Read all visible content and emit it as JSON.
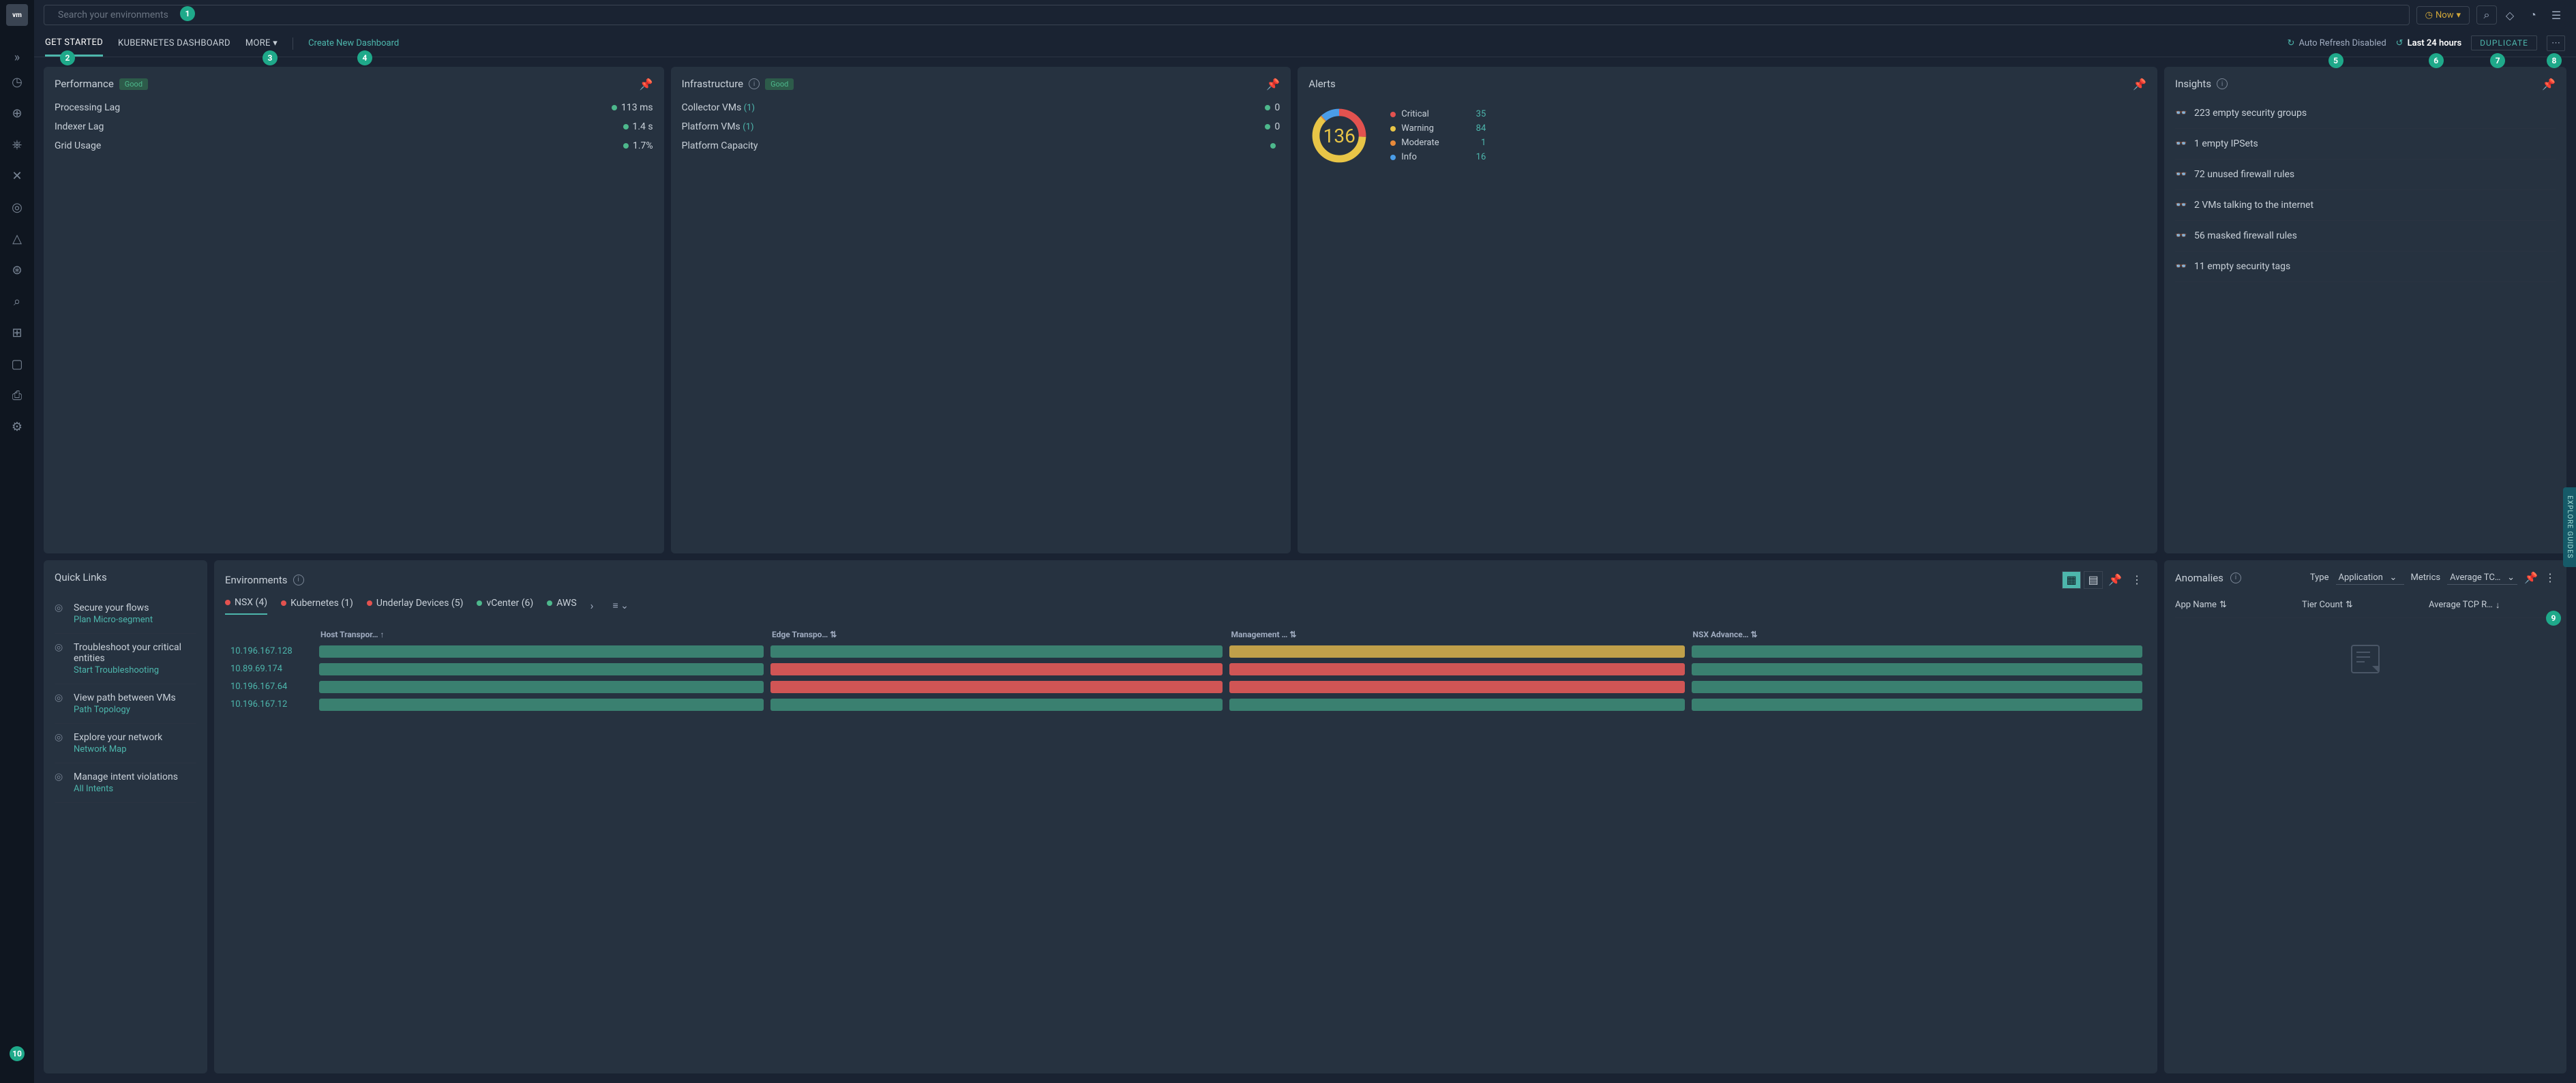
{
  "search": {
    "placeholder": "Search your environments"
  },
  "timePicker": {
    "now": "Now"
  },
  "tabs": {
    "getStarted": "GET STARTED",
    "kubernetes": "KUBERNETES DASHBOARD",
    "more": "MORE",
    "createNew": "Create New Dashboard"
  },
  "dashboardActions": {
    "autoRefresh": "Auto Refresh Disabled",
    "timeRange": "Last 24 hours",
    "duplicate": "DUPLICATE"
  },
  "performance": {
    "title": "Performance",
    "status": "Good",
    "metrics": [
      {
        "label": "Processing Lag",
        "value": "113 ms"
      },
      {
        "label": "Indexer Lag",
        "value": "1.4 s"
      },
      {
        "label": "Grid Usage",
        "value": "1.7%"
      }
    ]
  },
  "infrastructure": {
    "title": "Infrastructure",
    "status": "Good",
    "metrics": [
      {
        "label": "Collector VMs",
        "count": "(1)",
        "value": "0"
      },
      {
        "label": "Platform VMs",
        "count": "(1)",
        "value": "0"
      },
      {
        "label": "Platform Capacity",
        "value": ""
      }
    ]
  },
  "alerts": {
    "title": "Alerts",
    "total": "136",
    "legend": [
      {
        "label": "Critical",
        "count": "35",
        "color": "red"
      },
      {
        "label": "Warning",
        "count": "84",
        "color": "yellow"
      },
      {
        "label": "Moderate",
        "count": "1",
        "color": "orange"
      },
      {
        "label": "Info",
        "count": "16",
        "color": "blue"
      }
    ]
  },
  "quickLinks": {
    "title": "Quick Links",
    "items": [
      {
        "text": "Secure your flows",
        "link": "Plan Micro-segment"
      },
      {
        "text": "Troubleshoot your critical entities",
        "link": "Start Troubleshooting"
      },
      {
        "text": "View path between VMs",
        "link": "Path Topology"
      },
      {
        "text": "Explore your network",
        "link": "Network Map"
      },
      {
        "text": "Manage intent violations",
        "link": "All Intents"
      }
    ]
  },
  "environments": {
    "title": "Environments",
    "tabs": [
      {
        "label": "NSX (4)",
        "color": "red",
        "active": true
      },
      {
        "label": "Kubernetes (1)",
        "color": "red"
      },
      {
        "label": "Underlay Devices (5)",
        "color": "red"
      },
      {
        "label": "vCenter (6)",
        "color": "green"
      },
      {
        "label": "AWS",
        "color": "green"
      }
    ],
    "columns": [
      "Host Transpor…",
      "Edge Transpo…",
      "Management …",
      "NSX Advance…"
    ],
    "rows": [
      {
        "host": "10.196.167.128",
        "cells": [
          "green",
          "green",
          "yellow",
          "green"
        ]
      },
      {
        "host": "10.89.69.174",
        "cells": [
          "green",
          "red",
          "red",
          "green"
        ]
      },
      {
        "host": "10.196.167.64",
        "cells": [
          "green",
          "red",
          "red",
          "green"
        ]
      },
      {
        "host": "10.196.167.12",
        "cells": [
          "green",
          "green",
          "green",
          "green"
        ]
      }
    ]
  },
  "insights": {
    "title": "Insights",
    "items": [
      "223 empty security groups",
      "1 empty IPSets",
      "72 unused firewall rules",
      "2 VMs talking to the internet",
      "56 masked firewall rules",
      "11 empty security tags"
    ]
  },
  "anomalies": {
    "title": "Anomalies",
    "typeLabel": "Type",
    "typeValue": "Application",
    "metricsLabel": "Metrics",
    "metricsValue": "Average TC…",
    "columns": [
      "App Name",
      "Tier Count",
      "Average TCP R…"
    ]
  },
  "exploreGuides": "EXPLORE GUIDES",
  "hints": [
    "1",
    "2",
    "3",
    "4",
    "5",
    "6",
    "7",
    "8",
    "9",
    "10"
  ]
}
